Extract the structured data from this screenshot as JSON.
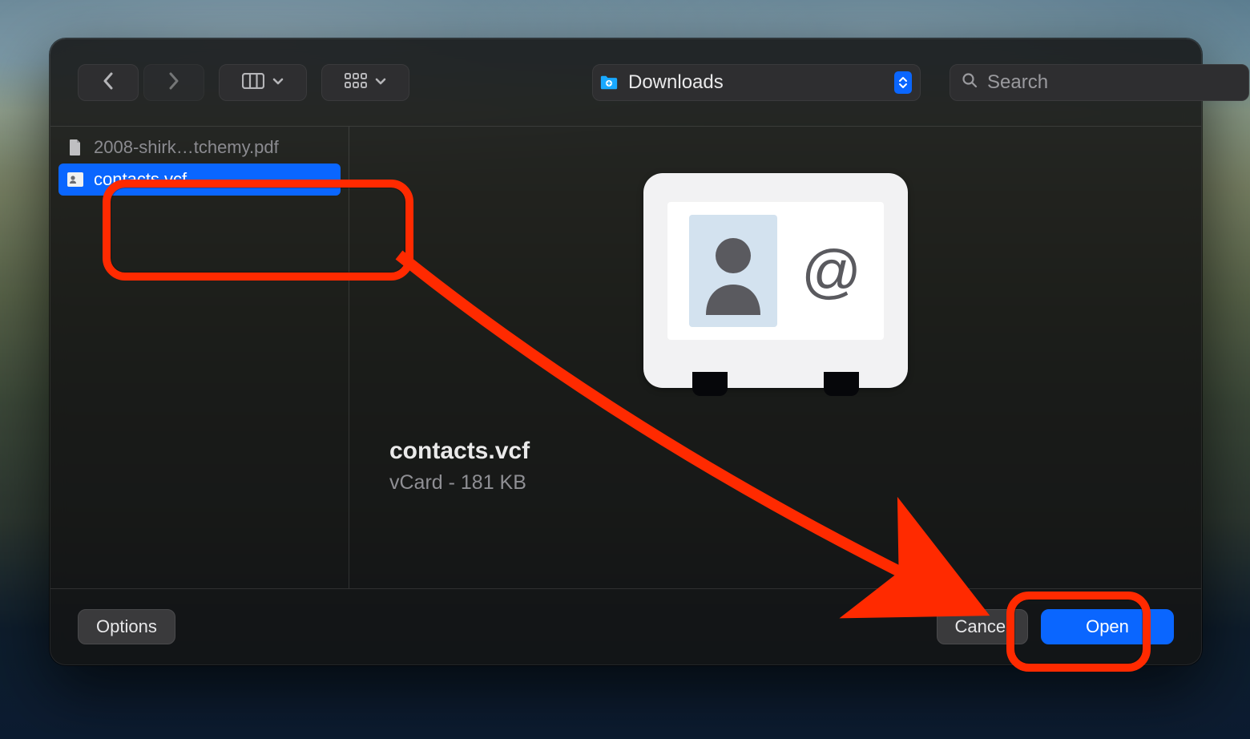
{
  "toolbar": {
    "location_label": "Downloads",
    "search_placeholder": "Search"
  },
  "files": [
    {
      "name": "2008-shirk…tchemy.pdf",
      "selected": false,
      "dimmed": true,
      "icon": "doc"
    },
    {
      "name": "contacts.vcf",
      "selected": true,
      "dimmed": false,
      "icon": "vcard"
    }
  ],
  "preview": {
    "filename": "contacts.vcf",
    "subtitle": "vCard - 181 KB"
  },
  "footer": {
    "options_label": "Options",
    "cancel_label": "Cancel",
    "open_label": "Open"
  },
  "annotation": {
    "highlights": [
      "file-row-contacts",
      "open-button"
    ]
  }
}
